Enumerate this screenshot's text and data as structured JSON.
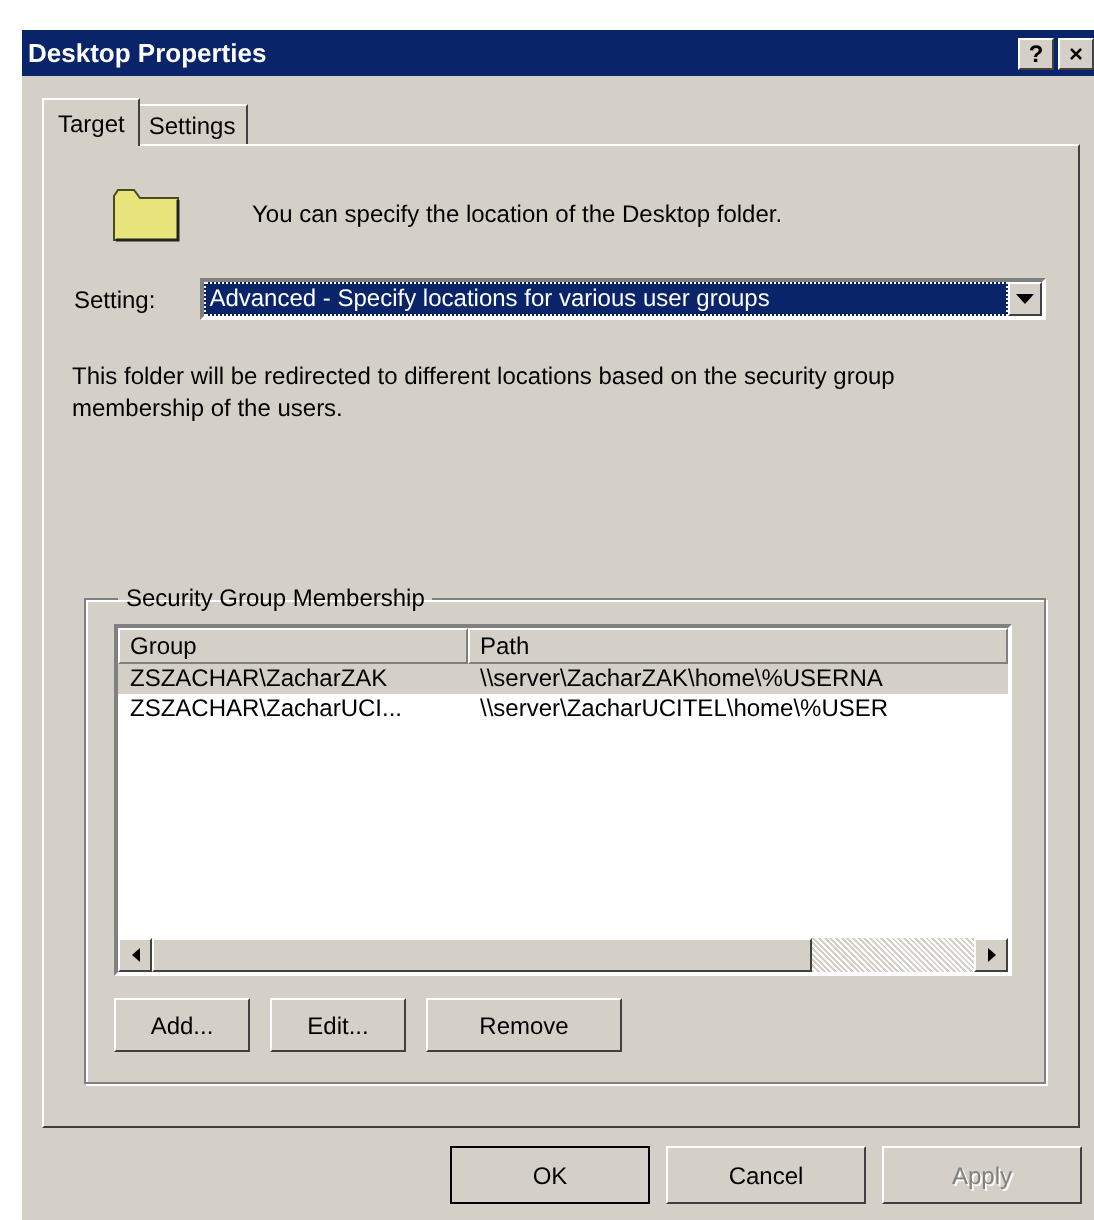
{
  "window": {
    "title": "Desktop Properties",
    "help_button": "?",
    "close_button": "×"
  },
  "tabs": [
    {
      "label": "Target",
      "selected": true
    },
    {
      "label": "Settings",
      "selected": false
    }
  ],
  "intro": "You can specify the location of the Desktop folder.",
  "setting": {
    "label": "Setting:",
    "value": "Advanced - Specify locations for various user groups"
  },
  "description": "This folder will be redirected to different locations based on the security group membership of the users.",
  "group_box": {
    "title": "Security Group Membership",
    "columns": [
      "Group",
      "Path"
    ],
    "rows": [
      {
        "group": "ZSZACHAR\\ZacharZAK",
        "path": "\\\\server\\ZacharZAK\\home\\%USERNA",
        "selected": true
      },
      {
        "group": "ZSZACHAR\\ZacharUCI...",
        "path": "\\\\server\\ZacharUCITEL\\home\\%USER",
        "selected": false
      }
    ],
    "buttons": [
      {
        "label": "Add..."
      },
      {
        "label": "Edit..."
      },
      {
        "label": "Remove"
      }
    ]
  },
  "buttons": [
    {
      "label": "OK",
      "disabled": false,
      "default": true
    },
    {
      "label": "Cancel",
      "disabled": false,
      "default": false
    },
    {
      "label": "Apply",
      "disabled": true,
      "default": false
    }
  ]
}
